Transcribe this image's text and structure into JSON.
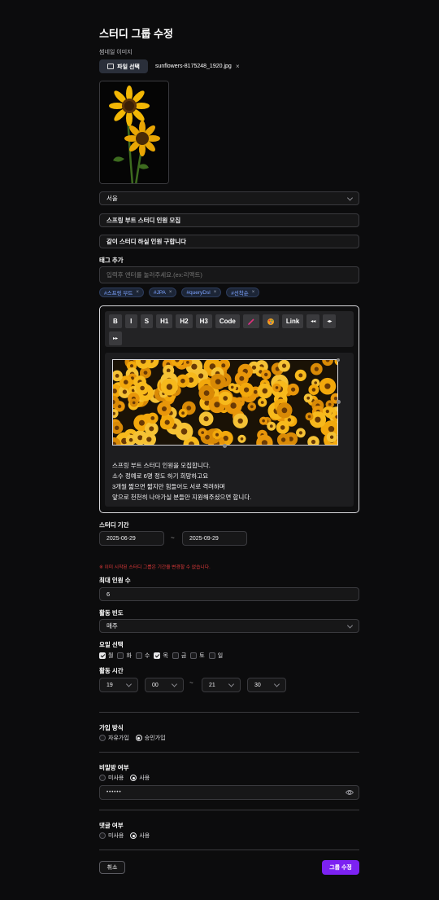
{
  "page": {
    "title": "스터디 그룹 수정"
  },
  "thumbnail": {
    "label": "썸네일 이미지",
    "button_label": "파일 선택",
    "file_name": "sunflowers-8175248_1920.jpg",
    "remove": "×"
  },
  "region": {
    "value": "서울"
  },
  "study_title": {
    "value": "스프링 부트 스터디 인원 모집"
  },
  "summary": {
    "value": "같이 스터디 하실 인원 구합니다"
  },
  "tags": {
    "label": "태그 추가",
    "placeholder": "입력후 엔터를 눌러주세요.(ex:리액트)",
    "items": [
      {
        "label": "#스프링 부트",
        "remove": "×"
      },
      {
        "label": "#JPA",
        "remove": "×"
      },
      {
        "label": "#queryDsl",
        "remove": "×"
      },
      {
        "label": "#선착순",
        "remove": "×"
      }
    ]
  },
  "editor": {
    "toolbar": [
      "B",
      "I",
      "S",
      "H1",
      "H2",
      "H3",
      "Code",
      "pen-icon",
      "palette-icon",
      "Link",
      "◂◂",
      "◂▸",
      "▸▸"
    ],
    "lines": [
      "스프링 부트 스터디 인원을 모집합니다.",
      "소수 정예로 6명 정도 하기 희망하고요",
      "3개월 짧으면 짧지만 힘들어도 서로 격려하며",
      "앞으로 천천히 나아가실 분들만 지원해주셨으면 합니다."
    ]
  },
  "period": {
    "label": "스터디 기간",
    "start": "2025-06-29",
    "separator": "~",
    "end": "2025-09-29",
    "warning": "※ 이미 시작된 스터디 그룹은 기간을 변경할 수 없습니다."
  },
  "max_members": {
    "label": "최대 인원 수",
    "value": "6"
  },
  "frequency": {
    "label": "활동 빈도",
    "value": "매주"
  },
  "days": {
    "label": "요일 선택",
    "items": [
      {
        "label": "월",
        "checked": true
      },
      {
        "label": "화",
        "checked": false
      },
      {
        "label": "수",
        "checked": false
      },
      {
        "label": "목",
        "checked": true
      },
      {
        "label": "금",
        "checked": false
      },
      {
        "label": "토",
        "checked": false
      },
      {
        "label": "일",
        "checked": false
      }
    ]
  },
  "time": {
    "label": "활동 시간",
    "start_hour": "19",
    "start_minute": "00",
    "separator": "~",
    "end_hour": "21",
    "end_minute": "30"
  },
  "join": {
    "label": "가입 방식",
    "options": [
      "자유가입",
      "승인가입"
    ],
    "selected": "승인가입"
  },
  "secret": {
    "label": "비밀방 여부",
    "options": [
      "미사용",
      "사용"
    ],
    "selected": "사용",
    "password_value": "••••••"
  },
  "comments": {
    "label": "댓글 여부",
    "options": [
      "미사용",
      "사용"
    ],
    "selected": "사용"
  },
  "actions": {
    "cancel": "취소",
    "submit": "그룹 수정"
  },
  "colors": {
    "accent": "#7c22f2",
    "background": "#0c0c0d",
    "warning": "#e03a3a",
    "tag_text": "#7da3ff"
  }
}
